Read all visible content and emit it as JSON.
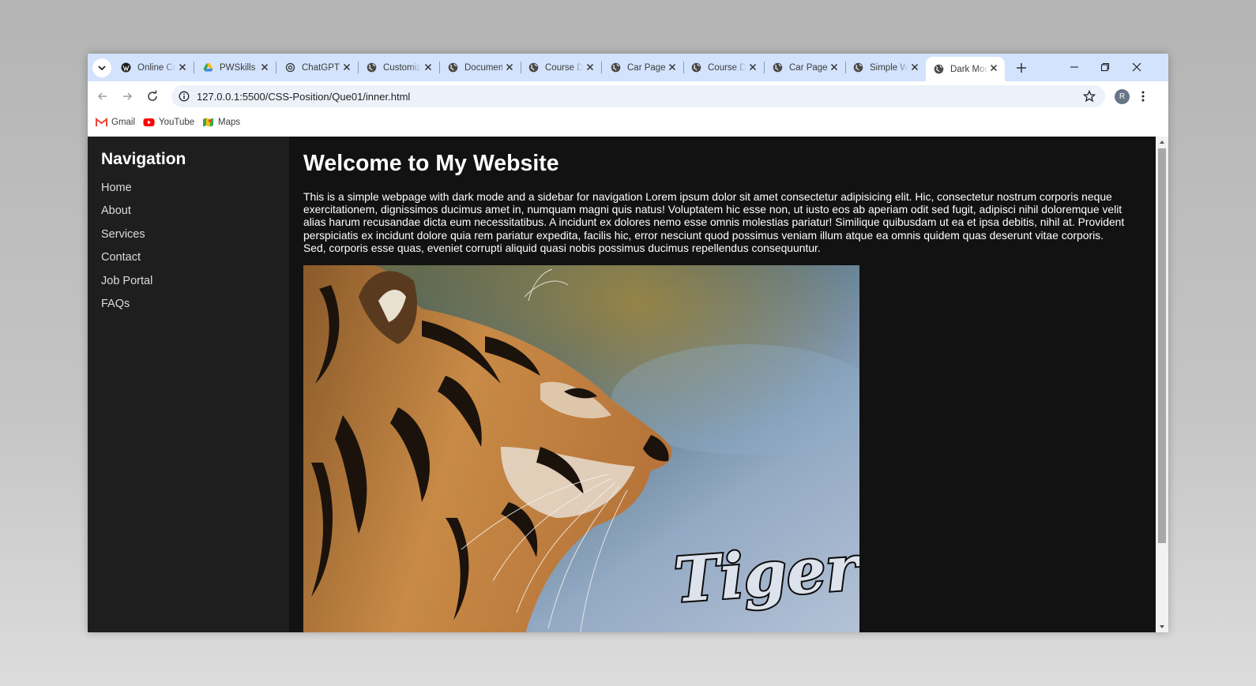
{
  "browser": {
    "tabs": [
      {
        "title": "Online Compiler",
        "favicon": "wordpress-icon",
        "active": false
      },
      {
        "title": "PWSkills",
        "favicon": "google-drive-icon",
        "active": false
      },
      {
        "title": "ChatGPT",
        "favicon": "openai-icon",
        "active": false
      },
      {
        "title": "Customize",
        "favicon": "globe-icon",
        "active": false
      },
      {
        "title": "Document",
        "favicon": "globe-icon",
        "active": false
      },
      {
        "title": "Course Details",
        "favicon": "globe-icon",
        "active": false
      },
      {
        "title": "Car Page",
        "favicon": "globe-icon",
        "active": false
      },
      {
        "title": "Course Details",
        "favicon": "globe-icon",
        "active": false
      },
      {
        "title": "Car Page",
        "favicon": "globe-icon",
        "active": false
      },
      {
        "title": "Simple Website",
        "favicon": "globe-icon",
        "active": false
      },
      {
        "title": "Dark Mode",
        "favicon": "globe-icon",
        "active": true
      }
    ],
    "url": "127.0.0.1:5500/CSS-Position/Que01/inner.html",
    "profile_initial": "R",
    "bookmarks": [
      {
        "label": "Gmail",
        "icon": "gmail-icon"
      },
      {
        "label": "YouTube",
        "icon": "youtube-icon"
      },
      {
        "label": "Maps",
        "icon": "maps-icon"
      }
    ]
  },
  "page": {
    "sidebar": {
      "title": "Navigation",
      "items": [
        "Home",
        "About",
        "Services",
        "Contact",
        "Job Portal",
        "FAQs"
      ]
    },
    "main": {
      "heading": "Welcome to My Website",
      "paragraph": "This is a simple webpage with dark mode and a sidebar for navigation Lorem ipsum dolor sit amet consectetur adipisicing elit. Hic, consectetur nostrum corporis neque exercitationem, dignissimos ducimus amet in, numquam magni quis natus! Voluptatem hic esse non, ut iusto eos ab aperiam odit sed fugit, adipisci nihil doloremque velit alias harum recusandae dicta eum necessitatibus. A incidunt ex dolores nemo esse omnis molestias pariatur! Similique quibusdam ut ea et ipsa debitis, nihil at. Provident perspiciatis ex incidunt dolore quia rem pariatur expedita, facilis hic, error nesciunt quod possimus veniam illum atque ea omnis quidem quas deserunt vitae corporis. Sed, corporis esse quas, eveniet corrupti aliquid quasi nobis possimus ducimus repellendus consequuntur.",
      "image_caption": "Tiger"
    }
  },
  "colors": {
    "tabstrip": "#d3e3fd",
    "page_bg": "#121212",
    "sidebar_bg": "#1e1e1e",
    "text": "#ffffff"
  }
}
